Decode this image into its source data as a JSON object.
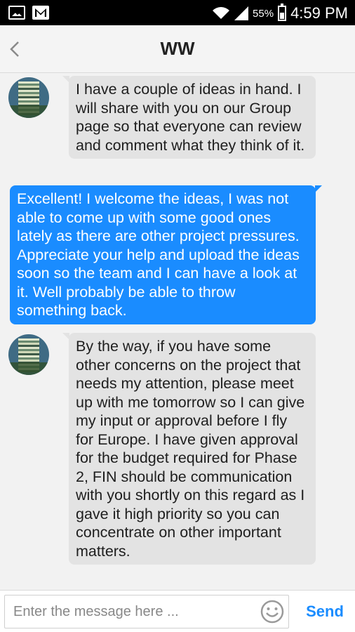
{
  "status_bar": {
    "battery_percent": "55%",
    "time": "4:59 PM",
    "icons": [
      "gallery-icon",
      "gmail-icon",
      "wifi-icon",
      "signal-icon",
      "battery-icon"
    ]
  },
  "header": {
    "title": "WW",
    "back_icon": "chevron-left-icon"
  },
  "messages": [
    {
      "direction": "incoming",
      "text": "I have a couple of ideas in hand. I will share with you on our Group page so that everyone can review and comment what they think of it."
    },
    {
      "direction": "outgoing",
      "text": "Excellent! I welcome the ideas, I was not able to come up with some good ones lately as there are other project pressures. Appreciate your help and upload the ideas soon so the team and I can have a look at it. Well probably be able to throw something back."
    },
    {
      "direction": "incoming",
      "text": "By the way, if you have some other concerns on the project that needs my attention, please meet up with me tomorrow so I can give my input or approval before I fly for Europe. I have given approval for the budget required for Phase 2, FIN should be communication with you shortly on this regard as I gave it high priority so you can concentrate on other important matters."
    }
  ],
  "composer": {
    "placeholder": "Enter the message here ...",
    "value": "",
    "emoji_icon": "smiley-icon",
    "send_label": "Send"
  },
  "colors": {
    "outgoing_bubble": "#1a8cff",
    "incoming_bubble": "#e3e3e3",
    "send_text": "#1a8cff",
    "background": "#f2f2f2"
  }
}
